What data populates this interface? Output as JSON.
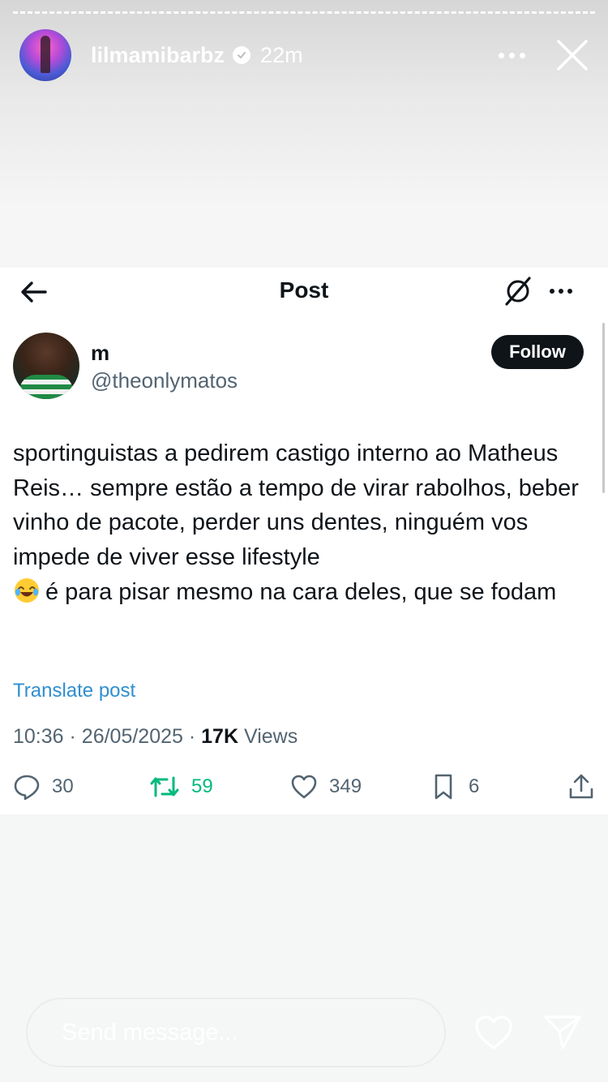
{
  "story": {
    "username": "lilmamibarbz",
    "time": "22m",
    "icons": {
      "verified": "verified-badge-icon",
      "more": "more-horizontal-icon",
      "close": "close-icon"
    }
  },
  "post": {
    "nav_title": "Post",
    "author_name": "m",
    "author_handle": "@theonlymatos",
    "follow_label": "Follow",
    "body_text": "sportinguistas a pedirem castigo interno ao Matheus Reis… sempre estão a tempo de virar rabolhos, beber vinho de pacote, perder uns dentes, ninguém vos impede de viver esse lifestyle",
    "body_emoji": "😂",
    "body_text_after": "é para pisar mesmo na cara deles, que se fodam",
    "translate_label": "Translate post",
    "meta": {
      "time": "10:36",
      "date": "26/05/2025",
      "separator": "·",
      "views_count": "17K",
      "views_label": "Views"
    },
    "actions": {
      "replies": "30",
      "reposts": "59",
      "likes": "349",
      "bookmarks": "6"
    }
  },
  "composer": {
    "placeholder": "Send message..."
  },
  "colors": {
    "link": "#2f8fcf",
    "repost": "#00ba7c",
    "text": "#0f1419",
    "muted": "#536471"
  }
}
